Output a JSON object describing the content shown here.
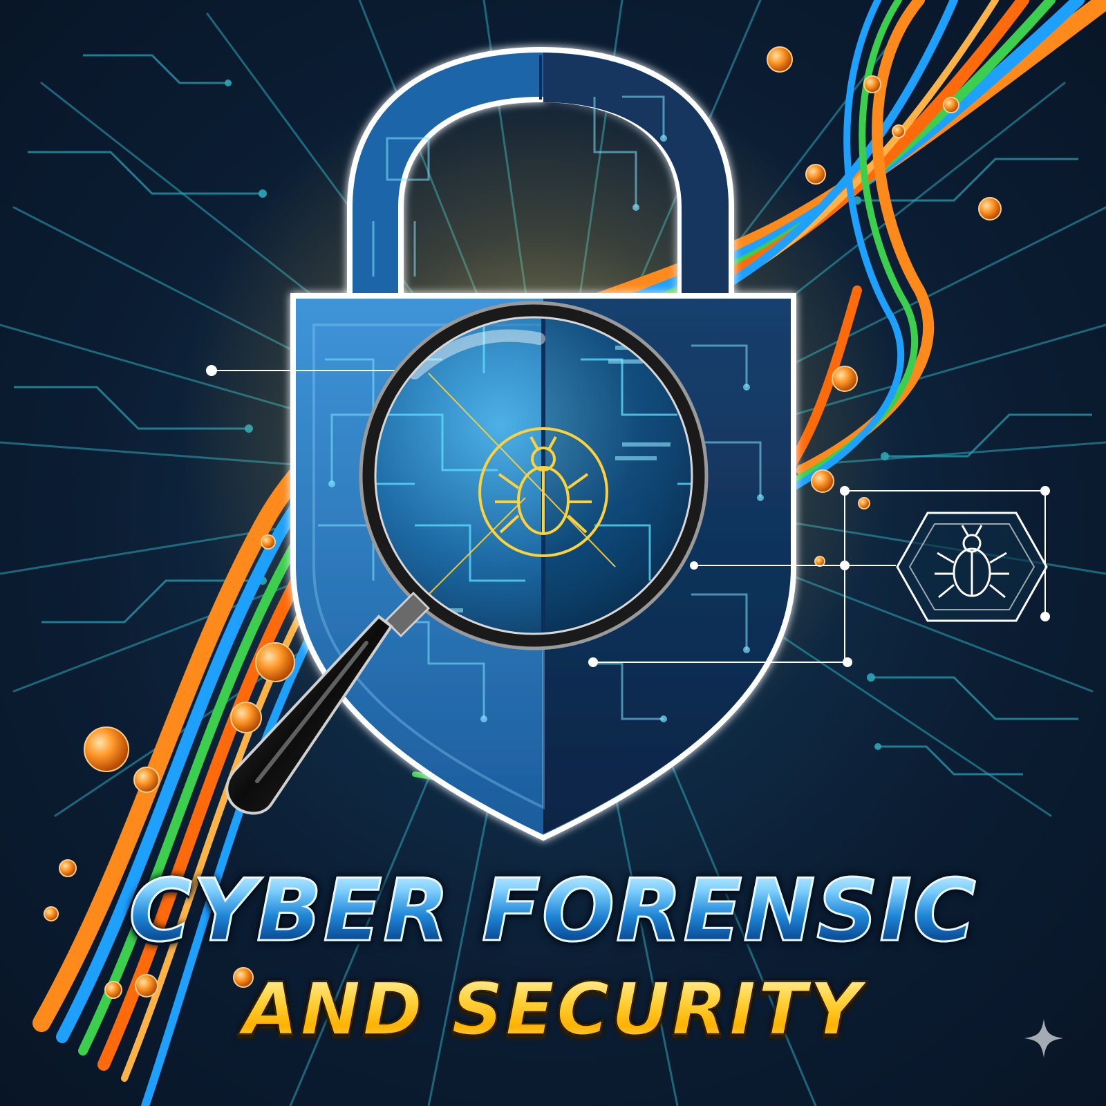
{
  "poster": {
    "title_line1": "CYBER FORENSIC",
    "title_line2": "AND SECURITY"
  },
  "icons": {
    "lock": "padlock-icon",
    "magnifier": "magnifying-glass-icon",
    "bug_center": "bug-icon",
    "bug_side": "bug-icon",
    "sparkle": "sparkle-icon"
  },
  "colors": {
    "background": "#0b1d33",
    "circuit": "#2aa7b8",
    "shield_light": "#2f7fc4",
    "shield_dark": "#0f2f5a",
    "glow": "#ffd23a",
    "cable_orange": "#ff8a1c",
    "cable_blue": "#1ea0ff",
    "cable_green": "#3ccf4e",
    "title_blue": "#1f86d6",
    "title_gold": "#ffd23a"
  }
}
